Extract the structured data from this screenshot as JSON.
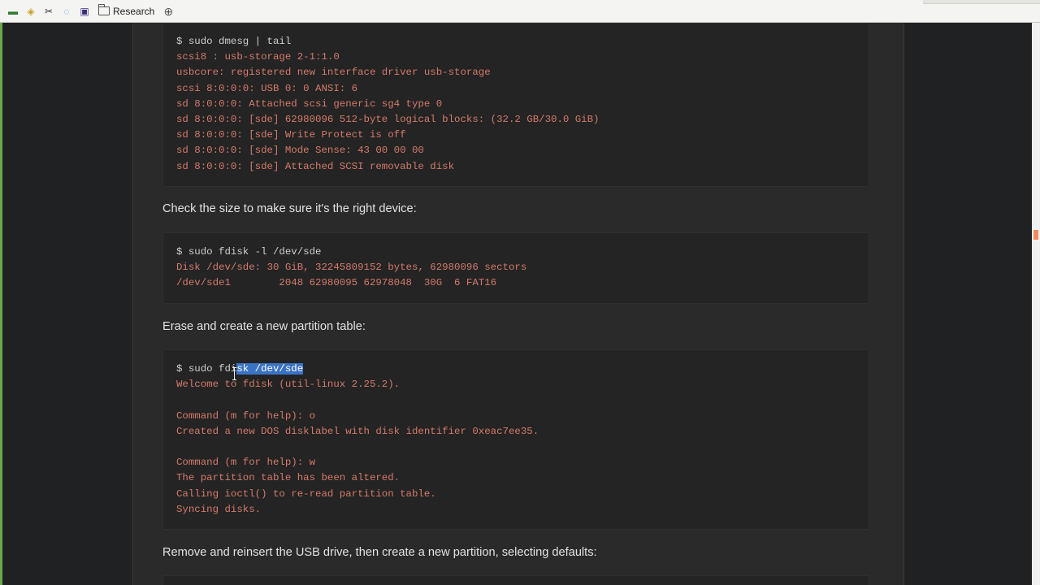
{
  "bookmarks": {
    "items": [
      {
        "icon": "bookmark-app-icon",
        "glyph": "▬",
        "color": "#2e7d32"
      },
      {
        "icon": "bookmark-shield-icon",
        "glyph": "◈",
        "color": "#c9a227"
      },
      {
        "icon": "bookmark-scissors-icon",
        "glyph": "✂",
        "color": "#333333"
      },
      {
        "icon": "bookmark-circle-icon",
        "glyph": "◌",
        "color": "#5aa0e0"
      },
      {
        "icon": "bookmark-lock-icon",
        "glyph": "▣",
        "color": "#3b2f7a"
      }
    ],
    "folder_label": "Research",
    "globe_glyph": "⊕"
  },
  "blocks": {
    "dmesg": [
      "$ sudo dmesg | tail",
      "scsi8 : usb-storage 2-1:1.0",
      "usbcore: registered new interface driver usb-storage",
      "scsi 8:0:0:0: USB 0: 0 ANSI: 6",
      "sd 8:0:0:0: Attached scsi generic sg4 type 0",
      "sd 8:0:0:0: [sde] 62980096 512-byte logical blocks: (32.2 GB/30.0 GiB)",
      "sd 8:0:0:0: [sde] Write Protect is off",
      "sd 8:0:0:0: [sde] Mode Sense: 43 00 00 00",
      "sd 8:0:0:0: [sde] Attached SCSI removable disk"
    ],
    "fdisk_list": [
      "$ sudo fdisk -l /dev/sde",
      "Disk /dev/sde: 30 GiB, 32245809152 bytes, 62980096 sectors",
      "/dev/sde1        2048 62980095 62978048  30G  6 FAT16"
    ],
    "fdisk_cmd_pre": "$ sudo fdi",
    "fdisk_cmd_sel": "sk /dev/sde",
    "fdisk_session": [
      "Welcome to fdisk (util-linux 2.25.2).",
      "",
      "Command (m for help): o",
      "Created a new DOS disklabel with disk identifier 0xeac7ee35.",
      "",
      "Command (m for help): w",
      "The partition table has been altered.",
      "Calling ioctl() to re-read partition table.",
      "Syncing disks."
    ]
  },
  "prose": {
    "check_size": "Check the size to make sure it's the right device:",
    "erase": "Erase and create a new partition table:",
    "reinsert": "Remove and reinsert the USB drive, then create a new partition, selecting defaults:"
  }
}
